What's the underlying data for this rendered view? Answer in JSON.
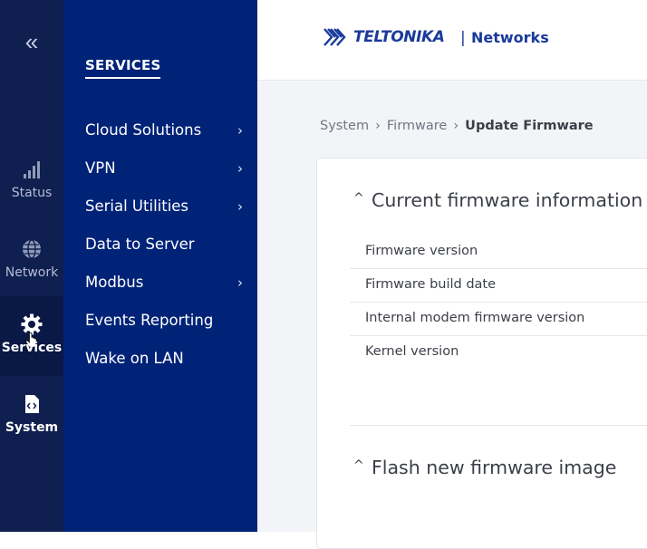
{
  "rail": {
    "collapse_label": "«",
    "items": [
      {
        "label": "Status",
        "icon": "signal-bars-icon"
      },
      {
        "label": "Network",
        "icon": "globe-icon"
      },
      {
        "label": "Services",
        "icon": "gear-icon"
      },
      {
        "label": "System",
        "icon": "file-code-icon"
      }
    ]
  },
  "submenu": {
    "title": "SERVICES",
    "items": [
      {
        "label": "Cloud Solutions",
        "chevron": "›"
      },
      {
        "label": "VPN",
        "chevron": "›"
      },
      {
        "label": "Serial Utilities",
        "chevron": "›"
      },
      {
        "label": "Data to Server"
      },
      {
        "label": "Modbus",
        "chevron": "›"
      },
      {
        "label": "Events Reporting"
      },
      {
        "label": "Wake on LAN"
      }
    ]
  },
  "header": {
    "brand": "TELTONIKA",
    "separator": "|",
    "brand_suffix": "Networks"
  },
  "breadcrumb": {
    "items": [
      "System",
      "Firmware",
      "Update Firmware"
    ],
    "separator": "›"
  },
  "sections": [
    {
      "title": "Current firmware information",
      "caret": "^",
      "rows": [
        "Firmware version",
        "Firmware build date",
        "Internal modem firmware version",
        "Kernel version"
      ]
    },
    {
      "title": "Flash new firmware image",
      "caret": "^"
    }
  ],
  "colors": {
    "rail_bg": "#0f1f4f",
    "submenu_bg": "#002378",
    "brand_blue": "#1a3a9b",
    "content_bg": "#f3f4f7"
  }
}
